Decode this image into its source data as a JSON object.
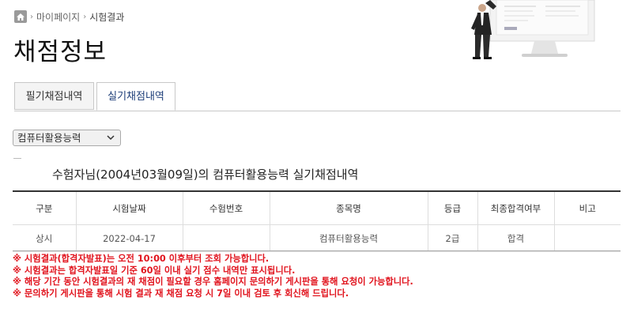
{
  "breadcrumb": {
    "home_icon": "home-icon",
    "items": [
      "마이페이지",
      "시험결과"
    ]
  },
  "page_title": "채점정보",
  "tabs": [
    {
      "label": "필기채점내역",
      "active": false
    },
    {
      "label": "실기채점내역",
      "active": true
    }
  ],
  "category_select": {
    "value": "컴퓨터활용능력"
  },
  "result_heading": "수험자님(2004년03월09일)의 컴퓨터활용능력 실기채점내역",
  "table": {
    "headers": [
      "구분",
      "시험날짜",
      "수험번호",
      "종목명",
      "등급",
      "최종합격여부",
      "비고"
    ],
    "rows": [
      [
        "상시",
        "2022-04-17",
        "",
        "컴퓨터활용능력",
        "2급",
        "합격",
        ""
      ]
    ]
  },
  "notices": [
    "※ 시험결과(합격자발표)는 오전 10:00 이후부터 조회 가능합니다.",
    "※ 시험결과는 합격자발표일 기준 60일 이내 실기 점수 내역만 표시됩니다.",
    "※ 해당 기간 동안 시험결과의 재 채점이 필요할 경우 홈페이지 문의하기 게시판을 통해 요청이 가능합니다.",
    "※ 문의하기 게시판을 통해 시험 결과 재 채점 요청 시 7일 이내 검토 후 회신해 드립니다."
  ],
  "colors": {
    "notice": "#e1141e",
    "active_tab_text": "#1c3d78",
    "table_top_border": "#333333"
  }
}
